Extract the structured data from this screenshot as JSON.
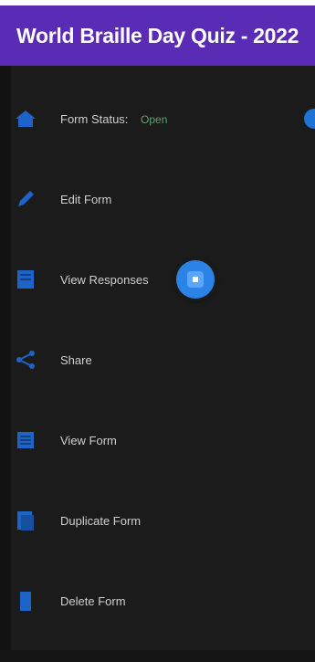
{
  "appbar": {
    "title": "World Braille Day Quiz - 2022"
  },
  "menu": {
    "items": [
      {
        "label": "Form Status:",
        "status": "Open",
        "icon": "home-icon"
      },
      {
        "label": "Edit Form",
        "icon": "pencil-icon"
      },
      {
        "label": "View Responses",
        "icon": "document-icon"
      },
      {
        "label": "Share",
        "icon": "share-icon"
      },
      {
        "label": "View Form",
        "icon": "list-icon"
      },
      {
        "label": "Duplicate Form",
        "icon": "copy-icon"
      },
      {
        "label": "Delete Form",
        "icon": "trash-icon"
      }
    ]
  },
  "colors": {
    "appbar": "#5a2bb4",
    "background": "#1b1b1b",
    "accent": "#2b83e6",
    "status_open": "#5fa36a"
  }
}
